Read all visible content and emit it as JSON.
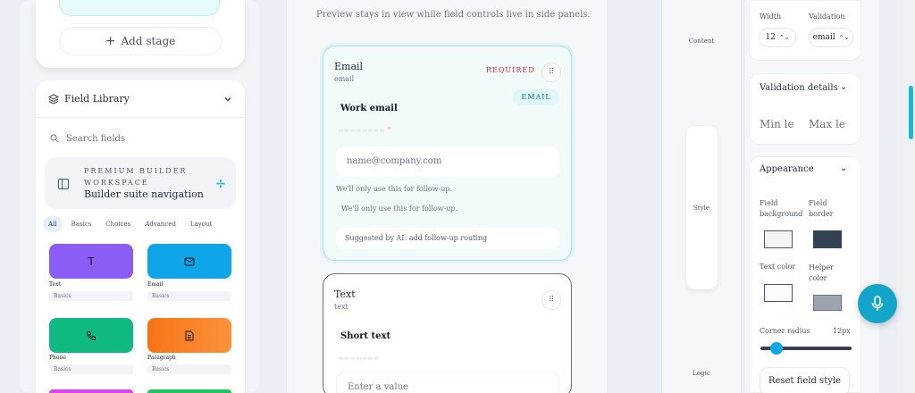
{
  "stages": {
    "add_stage_label": "Add stage"
  },
  "field_library": {
    "title": "Field Library",
    "search_placeholder": "Search fields",
    "premium": {
      "tag": "PREMIUM BUILDER WORKSPACE",
      "title": "Builder suite navigation"
    },
    "categories": [
      "All",
      "Basics",
      "Choices",
      "Advanced",
      "Layout"
    ],
    "active_category": "All",
    "tiles": [
      {
        "label": "Text",
        "category": "Basics",
        "icon": "text-icon",
        "color": "#8b5cf6"
      },
      {
        "label": "Email",
        "category": "Basics",
        "icon": "mail-icon",
        "color": "#0ea5e9"
      },
      {
        "label": "Phone",
        "category": "Basics",
        "icon": "phone-icon",
        "color": "#10b981"
      },
      {
        "label": "Paragraph",
        "category": "Basics",
        "icon": "document-icon",
        "color": "#f97316"
      }
    ]
  },
  "canvas": {
    "note": "Preview stays in view while field controls live in side panels.",
    "email_card": {
      "title": "Email",
      "subtitle": "email",
      "required_badge": "REQUIRED",
      "type_chip": "EMAIL",
      "label": "Work email",
      "placeholder": "name@company.com",
      "helper_1": "We'll only use this for follow-up.",
      "helper_2": "We'll only use this for follow-up.",
      "ai_suggestion": "Suggested by AI: add follow-up routing"
    },
    "text_card": {
      "title": "Text",
      "subtitle": "text",
      "label": "Short text",
      "placeholder": "Enter a value"
    }
  },
  "side_nav": {
    "items": [
      "Content",
      "Style",
      "Logic"
    ],
    "active": "Style"
  },
  "properties": {
    "width_label": "Width",
    "width_value": "12",
    "validation_label": "Validation",
    "validation_value": "email",
    "validation_details_title": "Validation details",
    "min_label": "Min le",
    "max_label": "Max le",
    "appearance_title": "Appearance",
    "field_background_label": "Field background",
    "field_border_label": "Field border",
    "text_color_label": "Text color",
    "helper_color_label": "Helper color",
    "colors": {
      "field_background": "#f3f4f6",
      "field_border": "#334155",
      "text_color": "#f9fafb",
      "helper_color": "#9ca3af"
    },
    "corner_radius_label": "Corner radius",
    "corner_radius_value": "12px",
    "reset_label": "Reset field style"
  },
  "accent_color": "#13a4c9"
}
